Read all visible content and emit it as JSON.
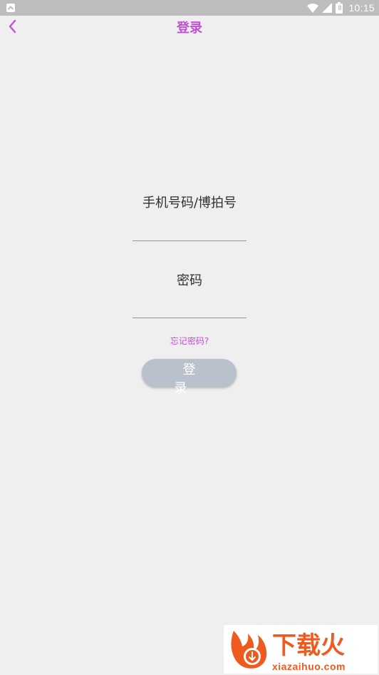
{
  "status_bar": {
    "time": "10:15",
    "battery": "8"
  },
  "header": {
    "title": "登录",
    "back_icon": "chevron-left-icon"
  },
  "form": {
    "phone_label": "手机号码/博拍号",
    "phone_value": "",
    "password_label": "密码",
    "password_value": "",
    "forgot_password": "忘记密码?",
    "login_button": "登 录"
  },
  "watermark": {
    "brand": "下载火",
    "domain": "xiazaihuo.com"
  },
  "colors": {
    "accent": "#c64fd8",
    "background": "#efefef",
    "button": "#b9c2cc",
    "status_bar": "#bdbdbd"
  }
}
